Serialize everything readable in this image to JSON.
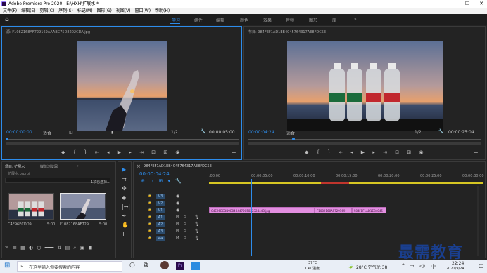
{
  "app": {
    "title": "Adobe Premiere Pro 2020 - E:\\HXH\\扩展水 *",
    "window_controls": [
      "—",
      "☐",
      "✕"
    ]
  },
  "menu": [
    "文件(F)",
    "编辑(E)",
    "剪辑(C)",
    "序列(S)",
    "标记(M)",
    "图形(G)",
    "视图(V)",
    "窗口(W)",
    "帮助(H)"
  ],
  "workspaces": {
    "tabs": [
      "学习",
      "组件",
      "编辑",
      "颜色",
      "效果",
      "音频",
      "图形",
      "库"
    ],
    "active": "学习",
    "more": "»"
  },
  "source_monitor": {
    "title": "源: F1082168AF729169AAABC75D8202CDA.jpg",
    "timecode": "00:00:00:00",
    "fit": "适合",
    "fraction": "1/2",
    "duration": "00:00:05:00"
  },
  "program_monitor": {
    "title": "节目: 984FEF1AD1EB4045764317AE8FDC5E",
    "timecode": "00:00:04:24",
    "fit": "适合",
    "fraction": "1/2",
    "duration": "00:00:25:04"
  },
  "project_panel": {
    "tabs": [
      "项目: 扩展水",
      "媒体浏览器"
    ],
    "more": "»",
    "project_file": "扩展水.prproj",
    "selection_info": "1项已选择...",
    "items": [
      {
        "name": "C4E96ECDD9...",
        "duration": "5:00"
      },
      {
        "name": "F1082168AF729...",
        "duration": "5:00"
      }
    ]
  },
  "timeline": {
    "tab": "984FEF1AD1EB4045764317AE8FDC5E",
    "timecode": "00:00:04:24",
    "ruler": [
      ":00:00",
      "00:00:05:00",
      "00:00:10:00",
      "00:00:15:00",
      "00:00:20:00",
      "00:00:25:00",
      "00:00:30:00"
    ],
    "video_tracks": [
      "V3",
      "V2",
      "V1"
    ],
    "audio_tracks": [
      "A1",
      "A2",
      "A3",
      "A4"
    ],
    "track_buttons": [
      "M",
      "S"
    ],
    "clips": [
      {
        "label": "C4E96ECDD9E84B4470C582232444B.jpg",
        "start": 0,
        "end": 12.5
      },
      {
        "label": "F1082168AF729169",
        "start": 12.5,
        "end": 16.9
      },
      {
        "label": "984FEF1AD1EB4045",
        "start": 16.9,
        "end": 21.0
      }
    ],
    "playhead": 4.96
  },
  "taskbar": {
    "search_placeholder": "在这里输入你要搜索的内容",
    "cpu_temp": "37°C",
    "cpu_label": "CPU温度",
    "weather": "28°C  空气优 38",
    "ime": "中",
    "time": "22:24",
    "date": "2021/9/24"
  },
  "watermark": "最需教育",
  "colors": {
    "accent": "#2d8ceb",
    "clip": "#e28ee0",
    "render_bar_yellow": "#d6c623",
    "render_bar_red": "#c0352d"
  }
}
